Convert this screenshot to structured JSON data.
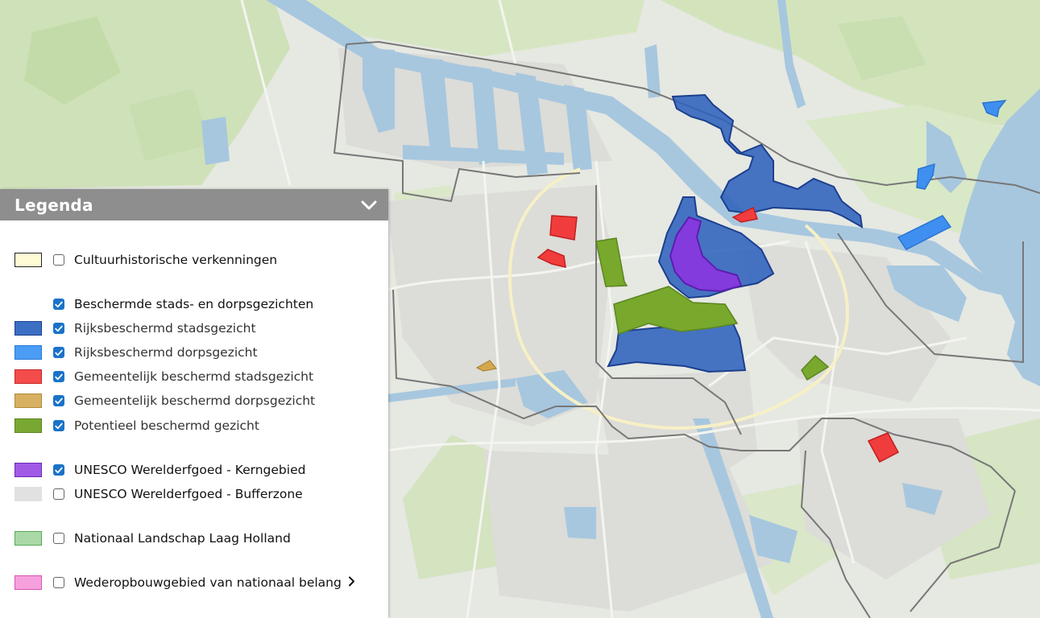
{
  "legend": {
    "title": "Legenda",
    "items": [
      {
        "label": "Cultuurhistorische verkenningen",
        "checked": false,
        "swatch_fill": "#fffbd5",
        "swatch_border": "#222222",
        "style": "bold"
      },
      {
        "label": "Beschermde stads- en dorpsgezichten",
        "checked": true,
        "swatch_fill": null,
        "swatch_border": null,
        "style": "bold"
      },
      {
        "label": "Rijksbeschermd stadsgezicht",
        "checked": true,
        "swatch_fill": "#3b6fc4",
        "swatch_border": "#1f3f8a",
        "style": "thin"
      },
      {
        "label": "Rijksbeschermd dorpsgezicht",
        "checked": true,
        "swatch_fill": "#4a9cf5",
        "swatch_border": "#2b7ad8",
        "style": "thin"
      },
      {
        "label": "Gemeentelijk beschermd stadsgezicht",
        "checked": true,
        "swatch_fill": "#f44b4b",
        "swatch_border": "#c82828",
        "style": "thin"
      },
      {
        "label": "Gemeentelijk beschermd dorpsgezicht",
        "checked": true,
        "swatch_fill": "#d8b062",
        "swatch_border": "#b08a3c",
        "style": "thin"
      },
      {
        "label": "Potentieel beschermd gezicht",
        "checked": true,
        "swatch_fill": "#79a832",
        "swatch_border": "#5a8420",
        "style": "thin"
      },
      {
        "label": "UNESCO Werelderfgoed - Kerngebied",
        "checked": true,
        "swatch_fill": "#a15ae6",
        "swatch_border": "#6a2cb5",
        "style": "bold"
      },
      {
        "label": "UNESCO Werelderfgoed - Bufferzone",
        "checked": false,
        "swatch_fill": "#e1e1e1",
        "swatch_border": "#e1e1e1",
        "style": "bold"
      },
      {
        "label": "Nationaal Landschap Laag Holland",
        "checked": false,
        "swatch_fill": "#a9d9a6",
        "swatch_border": "#5aa85a",
        "style": "bold"
      },
      {
        "label": "Wederopbouwgebied van nationaal belang",
        "checked": false,
        "swatch_fill": "#f7a0de",
        "swatch_border": "#d455b8",
        "style": "bold",
        "has_submenu": true
      }
    ]
  },
  "colors": {
    "rijks_stad": "#2f62bd",
    "rijks_dorp": "#3f8ff0",
    "gemeente_stad": "#f03c3c",
    "gemeente_dorp": "#d6a84e",
    "potentieel": "#78a82c",
    "unesco": "#8a35e0",
    "water": "#a6c8e0",
    "green": "#cfe2b8",
    "urban": "#e4e4e0",
    "boundary": "#7a7a7a"
  },
  "icons": {
    "collapse": "chevron-down-icon",
    "submenu": "chevron-right-icon",
    "check": "check-icon"
  }
}
